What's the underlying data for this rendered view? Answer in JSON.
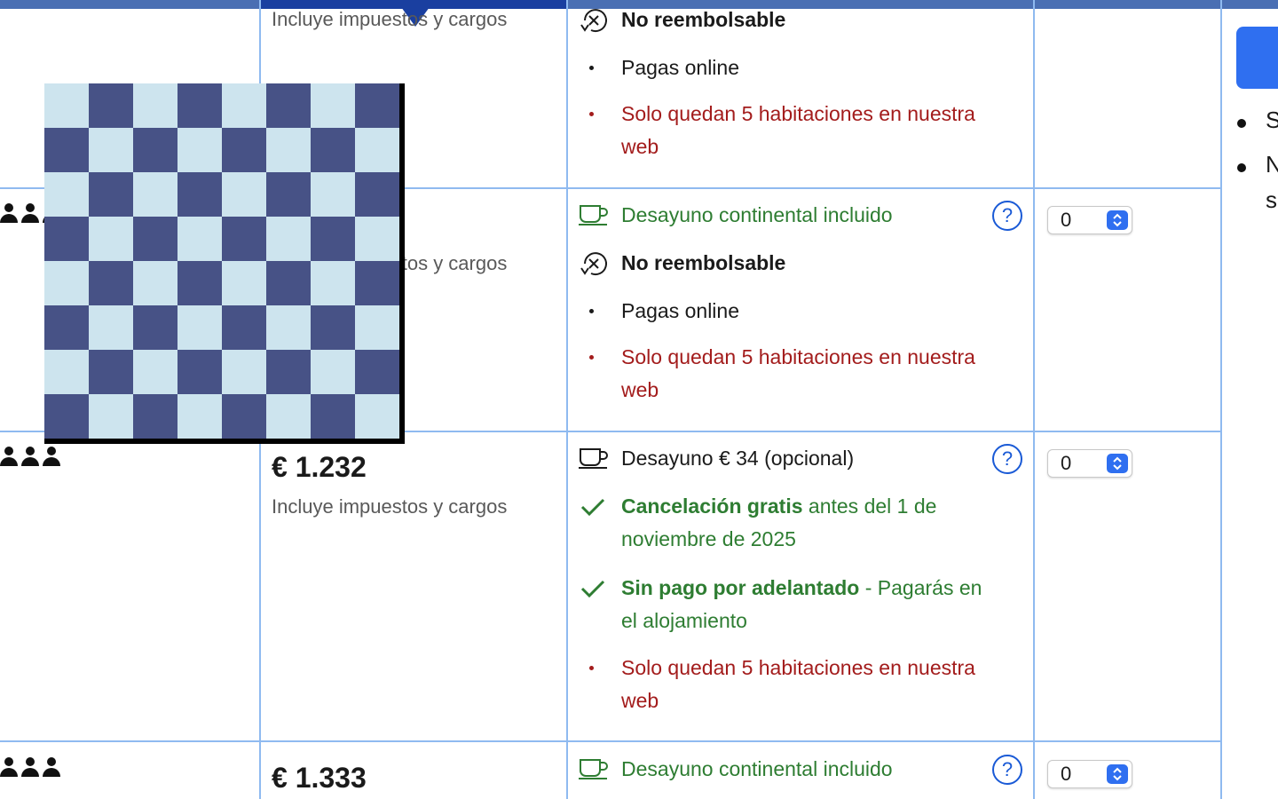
{
  "colors": {
    "accent_blue": "#2f6ff0",
    "header_blue": "#4a6fb3",
    "header_dark": "#1a3fa0",
    "grid_line": "#8fbaf0",
    "green": "#2e7d32",
    "red": "#a31c1c",
    "checker_light": "#cde4ee",
    "checker_dark": "#475286"
  },
  "rows": [
    {
      "tax_note": "Incluye impuestos y cargos",
      "conditions": [
        {
          "icon": "no-refund-icon",
          "text": "No reembolsable",
          "style": "bold"
        },
        {
          "icon": "bullet",
          "text": "Pagas online",
          "style": "normal"
        },
        {
          "icon": "bullet-red",
          "text": "Solo quedan 5 habitaciones en nuestra web",
          "style": "red"
        }
      ]
    },
    {
      "tax_note": "Incluye impuestos y cargos",
      "conditions": [
        {
          "icon": "coffee-cup-icon",
          "text": "Desayuno continental incluido",
          "style": "green"
        },
        {
          "icon": "no-refund-icon",
          "text": "No reembolsable",
          "style": "bold"
        },
        {
          "icon": "bullet",
          "text": "Pagas online",
          "style": "normal"
        },
        {
          "icon": "bullet-red",
          "text": "Solo quedan 5 habitaciones en nuestra web",
          "style": "red"
        }
      ],
      "qty": "0"
    },
    {
      "price": "€ 1.232",
      "tax_note": "Incluye impuestos y cargos",
      "conditions": [
        {
          "icon": "coffee-cup-icon",
          "text": "Desayuno € 34 (opcional)",
          "style": "normal"
        },
        {
          "icon": "check-icon",
          "bold": "Cancelación gratis",
          "text": " antes del 1 de noviembre de 2025",
          "style": "green"
        },
        {
          "icon": "check-icon",
          "bold": "Sin pago por adelantado",
          "text": " - Pagarás en el alojamiento",
          "style": "green"
        },
        {
          "icon": "bullet-red",
          "text": "Solo quedan 5 habitaciones en nuestra web",
          "style": "red"
        }
      ],
      "qty": "0"
    },
    {
      "price": "€ 1.333",
      "conditions": [
        {
          "icon": "coffee-cup-icon",
          "text": "Desayuno continental incluido",
          "style": "green"
        }
      ],
      "qty": "0"
    }
  ],
  "help_label": "?",
  "sidebar": {
    "items": [
      "S",
      "N",
      "s"
    ]
  }
}
